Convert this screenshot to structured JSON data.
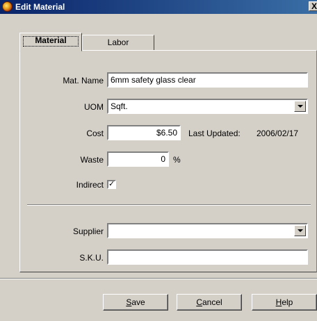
{
  "window": {
    "title": "Edit Material",
    "close_label": "X"
  },
  "tabs": [
    {
      "label": "Material",
      "active": true
    },
    {
      "label": "Labor",
      "active": false
    }
  ],
  "form": {
    "mat_name": {
      "label": "Mat. Name",
      "value": "6mm safety glass clear"
    },
    "uom": {
      "label": "UOM",
      "value": "Sqft."
    },
    "cost": {
      "label": "Cost",
      "value": "$6.50"
    },
    "last_updated": {
      "label": "Last Updated:",
      "value": "2006/02/17"
    },
    "waste": {
      "label": "Waste",
      "value": "0",
      "unit": "%"
    },
    "indirect": {
      "label": "Indirect",
      "checked": true,
      "mark": "✓"
    },
    "supplier": {
      "label": "Supplier",
      "value": ""
    },
    "sku": {
      "label": "S.K.U.",
      "value": ""
    }
  },
  "buttons": {
    "save": {
      "prefix": "",
      "mnemonic": "S",
      "rest": "ave"
    },
    "cancel": {
      "prefix": "",
      "mnemonic": "C",
      "rest": "ancel"
    },
    "help": {
      "prefix": "",
      "mnemonic": "H",
      "rest": "elp"
    }
  },
  "colors": {
    "titlebar_start": "#0a246a",
    "titlebar_end": "#3a6ea5",
    "face": "#d4d0c8"
  }
}
